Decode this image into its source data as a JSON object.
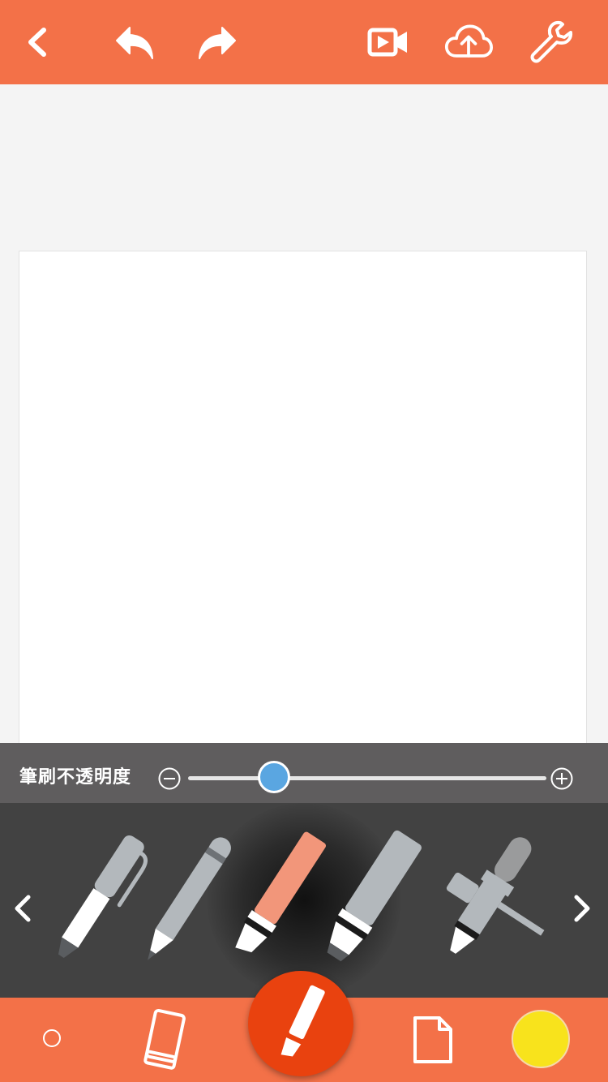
{
  "toolbar": {
    "back_icon": "chevron-left-icon",
    "undo_icon": "undo-icon",
    "redo_icon": "redo-icon",
    "record_icon": "video-record-icon",
    "upload_icon": "cloud-upload-icon",
    "settings_icon": "wrench-icon"
  },
  "opacity": {
    "label": "筆刷不透明度",
    "value": 0.24
  },
  "brushes": {
    "items": [
      "pen",
      "pencil",
      "marker",
      "highlighter",
      "airbrush"
    ],
    "selected": "marker"
  },
  "bottom": {
    "brush_size_icon": "brush-size-icon",
    "eraser_icon": "eraser-icon",
    "main_tool_icon": "brush-icon",
    "page_icon": "page-icon",
    "current_color": "#f8e31c"
  },
  "colors": {
    "accent": "#f37148",
    "active": "#e9420f",
    "slider": "#5aa6e1"
  }
}
